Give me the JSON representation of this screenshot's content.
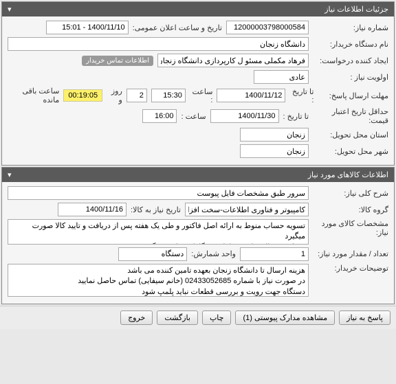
{
  "panel1": {
    "title": "جزئیات اطلاعات نیاز",
    "need_no_label": "شماره نیاز:",
    "need_no": "12000003798000584",
    "public_announce_label": "تاریخ و ساعت اعلان عمومی:",
    "public_announce": "1400/11/10 - 15:01",
    "buyer_label": "نام دستگاه خریدار:",
    "buyer": "دانشگاه زنجان",
    "requester_label": "ایجاد کننده درخواست:",
    "requester": "فرهاد مکملی مسئو ل کارپردازی دانشگاه زنجان",
    "buyer_contact_badge": "اطلاعات تماس خریدار",
    "priority_label": "اولویت نیاز :",
    "priority": "عادی",
    "reply_deadline_label": "مهلت ارسال پاسخ:",
    "reply_to_label": "تا تاریخ :",
    "reply_to_date": "1400/11/12",
    "reply_time_label": "ساعت :",
    "reply_time": "15:30",
    "days_val": "2",
    "days_label": "روز و",
    "timer": "00:19:05",
    "remain_label": "ساعت باقی مانده",
    "validity_label": "حداقل تاریخ اعتبار قیمت:",
    "validity_to_label": "تا تاریخ :",
    "validity_date": "1400/11/30",
    "validity_time_label": "ساعت :",
    "validity_time": "16:00",
    "province_label": "استان محل تحویل:",
    "province": "زنجان",
    "city_label": "شهر محل تحویل:",
    "city": "زنجان"
  },
  "panel2": {
    "title": "اطلاعات کالاهای مورد نیاز",
    "desc_label": "شرح کلی نیاز:",
    "desc": "سرور طبق مشخصات فایل پیوست",
    "group_label": "گروه کالا:",
    "group": "کامپیوتر و فناوری اطلاعات-سخت افزار",
    "need_to_date_label": "تاریخ نیاز به کالا:",
    "need_to_date": "1400/11/16",
    "specs_label": "مشخصات کالای مورد نیاز:",
    "specs": "تسویه حساب منوط به ارائه اصل فاکتور و طی یک هفته پس از دریافت و تایید کالا صورت میگیرد\nشماره سریال تمامی قطعات در گارانتی باید قید گردد",
    "qty_label": "تعداد / مقدار مورد نیاز:",
    "qty": "1",
    "unit_label": "واحد شمارش:",
    "unit": "دستگاه",
    "notes_label": "توضیحات خریدار:",
    "notes": "هزینه ارسال تا دانشگاه زنجان بعهده تامین کننده می باشد\nدر صورت نیاز با شماره 02433052685 (خانم سیفایی) تماس حاصل نمایید\nدستگاه جهت رویت و بررسی قطعات نباید پلمپ شود"
  },
  "buttons": {
    "reply": "پاسخ به نیاز",
    "attachments": "مشاهده مدارک پیوستی (1)",
    "print": "چاپ",
    "back": "بازگشت",
    "exit": "خروج"
  }
}
